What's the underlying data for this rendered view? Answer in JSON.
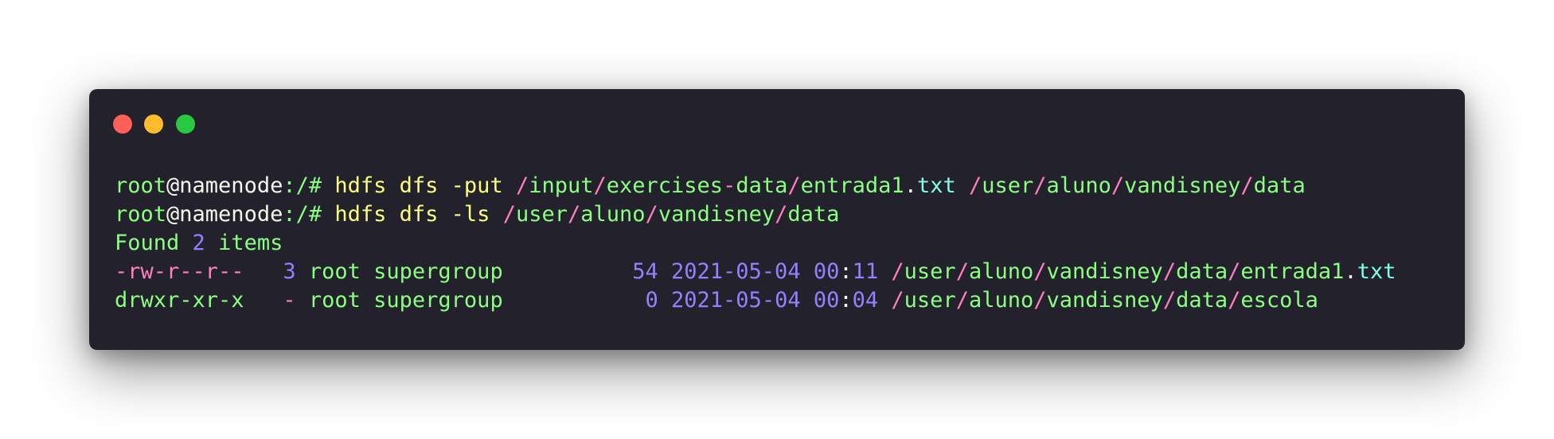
{
  "window": {
    "buttons": [
      "close",
      "minimize",
      "maximize"
    ],
    "colors": {
      "background": "#22212c",
      "close": "#ff5f57",
      "minimize": "#ffbd2e",
      "maximize": "#28c840"
    }
  },
  "palette": {
    "green": "#8aff80",
    "white": "#f8f8f2",
    "yellow": "#ffff80",
    "pink": "#ff80bf",
    "purple": "#9580ff",
    "cyan": "#80ffea"
  },
  "terminal": {
    "lines": [
      [
        {
          "text": "root",
          "color": "green"
        },
        {
          "text": "@namenode",
          "color": "white"
        },
        {
          "text": ":/# ",
          "color": "green"
        },
        {
          "text": "hdfs dfs -put ",
          "color": "yellow"
        },
        {
          "text": "/",
          "color": "pink"
        },
        {
          "text": "input",
          "color": "green"
        },
        {
          "text": "/",
          "color": "pink"
        },
        {
          "text": "exercises",
          "color": "green"
        },
        {
          "text": "-",
          "color": "pink"
        },
        {
          "text": "data",
          "color": "green"
        },
        {
          "text": "/",
          "color": "pink"
        },
        {
          "text": "entrada1",
          "color": "green"
        },
        {
          "text": ".",
          "color": "white"
        },
        {
          "text": "txt ",
          "color": "cyan"
        },
        {
          "text": "/",
          "color": "pink"
        },
        {
          "text": "user",
          "color": "green"
        },
        {
          "text": "/",
          "color": "pink"
        },
        {
          "text": "aluno",
          "color": "green"
        },
        {
          "text": "/",
          "color": "pink"
        },
        {
          "text": "vandisney",
          "color": "green"
        },
        {
          "text": "/",
          "color": "pink"
        },
        {
          "text": "data",
          "color": "green"
        }
      ],
      [
        {
          "text": "root",
          "color": "green"
        },
        {
          "text": "@namenode",
          "color": "white"
        },
        {
          "text": ":/# ",
          "color": "green"
        },
        {
          "text": "hdfs dfs -ls ",
          "color": "yellow"
        },
        {
          "text": "/",
          "color": "pink"
        },
        {
          "text": "user",
          "color": "green"
        },
        {
          "text": "/",
          "color": "pink"
        },
        {
          "text": "aluno",
          "color": "green"
        },
        {
          "text": "/",
          "color": "pink"
        },
        {
          "text": "vandisney",
          "color": "green"
        },
        {
          "text": "/",
          "color": "pink"
        },
        {
          "text": "data",
          "color": "green"
        }
      ],
      [
        {
          "text": "Found ",
          "color": "green"
        },
        {
          "text": "2",
          "color": "purple"
        },
        {
          "text": " items",
          "color": "green"
        }
      ],
      [
        {
          "text": "-rw-r--r--",
          "color": "pink"
        },
        {
          "text": "   ",
          "color": "white"
        },
        {
          "text": "3",
          "color": "purple"
        },
        {
          "text": " root supergroup          ",
          "color": "green"
        },
        {
          "text": "54 2021-05-04 00",
          "color": "purple"
        },
        {
          "text": ":",
          "color": "white"
        },
        {
          "text": "11 ",
          "color": "purple"
        },
        {
          "text": "/",
          "color": "pink"
        },
        {
          "text": "user",
          "color": "green"
        },
        {
          "text": "/",
          "color": "pink"
        },
        {
          "text": "aluno",
          "color": "green"
        },
        {
          "text": "/",
          "color": "pink"
        },
        {
          "text": "vandisney",
          "color": "green"
        },
        {
          "text": "/",
          "color": "pink"
        },
        {
          "text": "data",
          "color": "green"
        },
        {
          "text": "/",
          "color": "pink"
        },
        {
          "text": "entrada1",
          "color": "green"
        },
        {
          "text": ".",
          "color": "white"
        },
        {
          "text": "txt",
          "color": "cyan"
        }
      ],
      [
        {
          "text": "drwxr-xr-x",
          "color": "green"
        },
        {
          "text": "   ",
          "color": "white"
        },
        {
          "text": "-",
          "color": "pink"
        },
        {
          "text": " root supergroup           ",
          "color": "green"
        },
        {
          "text": "0 2021-05-04 00",
          "color": "purple"
        },
        {
          "text": ":",
          "color": "white"
        },
        {
          "text": "04 ",
          "color": "purple"
        },
        {
          "text": "/",
          "color": "pink"
        },
        {
          "text": "user",
          "color": "green"
        },
        {
          "text": "/",
          "color": "pink"
        },
        {
          "text": "aluno",
          "color": "green"
        },
        {
          "text": "/",
          "color": "pink"
        },
        {
          "text": "vandisney",
          "color": "green"
        },
        {
          "text": "/",
          "color": "pink"
        },
        {
          "text": "data",
          "color": "green"
        },
        {
          "text": "/",
          "color": "pink"
        },
        {
          "text": "escola",
          "color": "green"
        }
      ]
    ]
  }
}
